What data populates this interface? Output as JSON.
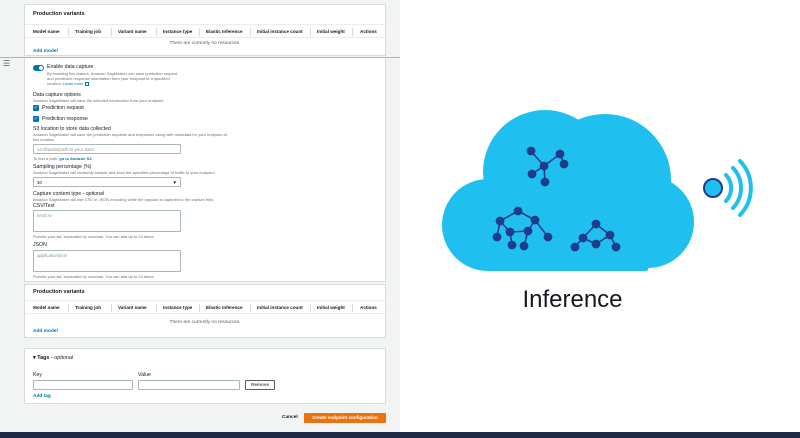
{
  "production_variants_top": {
    "title": "Production variants",
    "columns": [
      "Model name",
      "Training job",
      "Variant name",
      "Instance type",
      "Elastic Inference",
      "Initial instance count",
      "Initial weight",
      "Actions"
    ],
    "empty_message": "There are currently no resources.",
    "add_model": "Add model"
  },
  "data_capture": {
    "toggle_label": "Enable data capture",
    "toggle_desc_1": "By enabling this feature, Amazon SageMaker can save prediction request",
    "toggle_desc_2": "and prediction response information from your endpoint to a specified",
    "toggle_desc_3": "location.",
    "learn_more": "Learn more",
    "options_title": "Data capture options",
    "options_desc": "Amazon SageMaker will save the selected information from your endpoint",
    "prediction_request": "Prediction request",
    "prediction_response": "Prediction response",
    "s3_title": "S3 location to store data collected",
    "s3_desc_1": "Amazon SageMaker will save the prediction requests and responses along with metadata for your endpoint at",
    "s3_desc_2": "this location.",
    "s3_placeholder": "s3://bucket/path-to-your-data/",
    "s3_hint_prefix": "To find a path,",
    "s3_hint_link": "go to Amazon S3",
    "sampling_title": "Sampling percentage (%)",
    "sampling_desc": "Amazon SageMaker will randomly sample and save the specified percentage of traffic to your endpoint.",
    "sampling_value": "30",
    "content_type_title": "Capture content type",
    "content_type_optional": "- optional",
    "content_type_desc": "Amazon SageMaker will use CSV or JSON encoding while the payload is captured to the capture files.",
    "csv_label": "CSV/Text",
    "csv_placeholder": "text/csv",
    "csv_hint": "Provide your list, separated by commas. You can add up to 10 items.",
    "json_label": "JSON",
    "json_placeholder": "application/json",
    "json_hint": "Provide your list, separated by commas. You can add up to 10 items."
  },
  "production_variants_bottom": {
    "title": "Production variants",
    "columns": [
      "Model name",
      "Training job",
      "Variant name",
      "Instance type",
      "Elastic Inference",
      "Initial instance count",
      "Initial weight",
      "Actions"
    ],
    "empty_message": "There are currently no resources.",
    "add_model": "Add model"
  },
  "tags": {
    "title": "Tags",
    "optional": "- optional",
    "key_label": "Key",
    "value_label": "Value",
    "remove": "Remove",
    "add_tag": "Add tag"
  },
  "footer": {
    "cancel": "Cancel",
    "create": "Create endpoint configuration"
  },
  "illustration": {
    "title": "Inference",
    "cloud_color": "#1fc0f0",
    "node_color": "#1f3c8c",
    "signal_color": "#1fc0f0"
  }
}
